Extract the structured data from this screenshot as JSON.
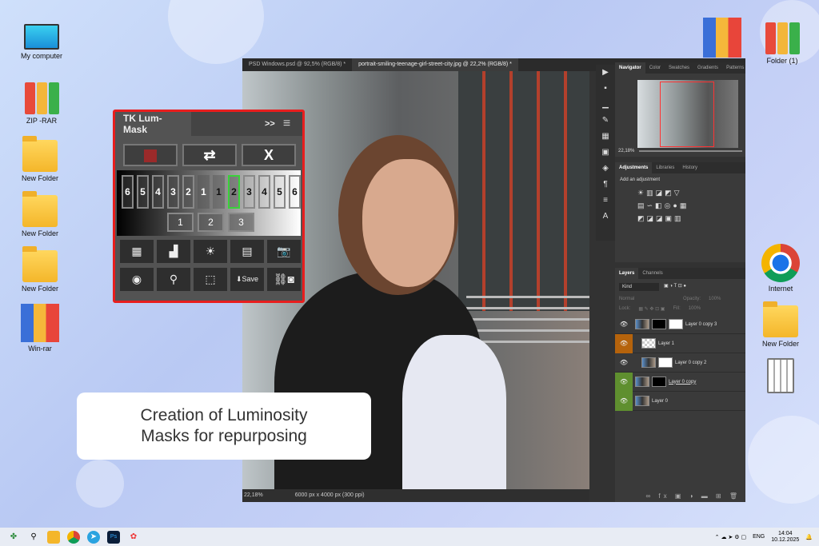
{
  "desktop": {
    "left_icons": [
      "My computer",
      "ZIP -RAR",
      "New Folder",
      "New Folder",
      "New Folder",
      "Win-rar"
    ],
    "right_icons": [
      "Folder (1)",
      "Internet",
      "New Folder"
    ]
  },
  "photoshop": {
    "tabs": [
      "PSD Windows.psd @ 92,5% (RGB/8) *",
      "portrait-smiling-teenage-girl-street-city.jpg @ 22,2% (RGB/8) *"
    ],
    "status": {
      "zoom": "22,18%",
      "size": "6000 px x 4000 px (300 ppi)"
    },
    "navigator": {
      "tabs": [
        "Navigator",
        "Color",
        "Swatches",
        "Gradients",
        "Patterns"
      ],
      "zoom": "22,18%"
    },
    "adjustments": {
      "tabs": [
        "Adjustments",
        "Libraries",
        "History"
      ],
      "hint": "Add an adjustment"
    },
    "layers": {
      "tabs": [
        "Layers",
        "Channels"
      ],
      "filter": "Kind",
      "blend": "Normal",
      "opacity_label": "Opacity:",
      "opacity": "100%",
      "lock_label": "Lock:",
      "fill_label": "Fill:",
      "fill": "100%",
      "items": [
        {
          "name": "Layer 0 copy 3"
        },
        {
          "name": "Layer 1"
        },
        {
          "name": "Layer 0 copy 2"
        },
        {
          "name": "Layer 0 copy"
        },
        {
          "name": "Layer 0"
        }
      ]
    }
  },
  "lummask": {
    "title": "TK Lum-Mask",
    "expand": ">>",
    "buttons": {
      "swap": "⇄",
      "close": "X"
    },
    "dark": [
      "6",
      "5",
      "4",
      "3",
      "2",
      "1"
    ],
    "light": [
      "1",
      "2",
      "3",
      "4",
      "5",
      "6"
    ],
    "mids": [
      "1",
      "2",
      "3"
    ],
    "save": "Save"
  },
  "caption": {
    "line1": "Creation of Luminosity",
    "line2": "Masks for repurposing"
  },
  "taskbar": {
    "lang": "ENG",
    "time": "14:04",
    "date": "10.12.2025"
  },
  "colors": {
    "accent_red": "#e81e1e",
    "selected_green": "#3ad13a",
    "layer_orange": "#b5630c",
    "layer_green": "#5f8f2f"
  }
}
